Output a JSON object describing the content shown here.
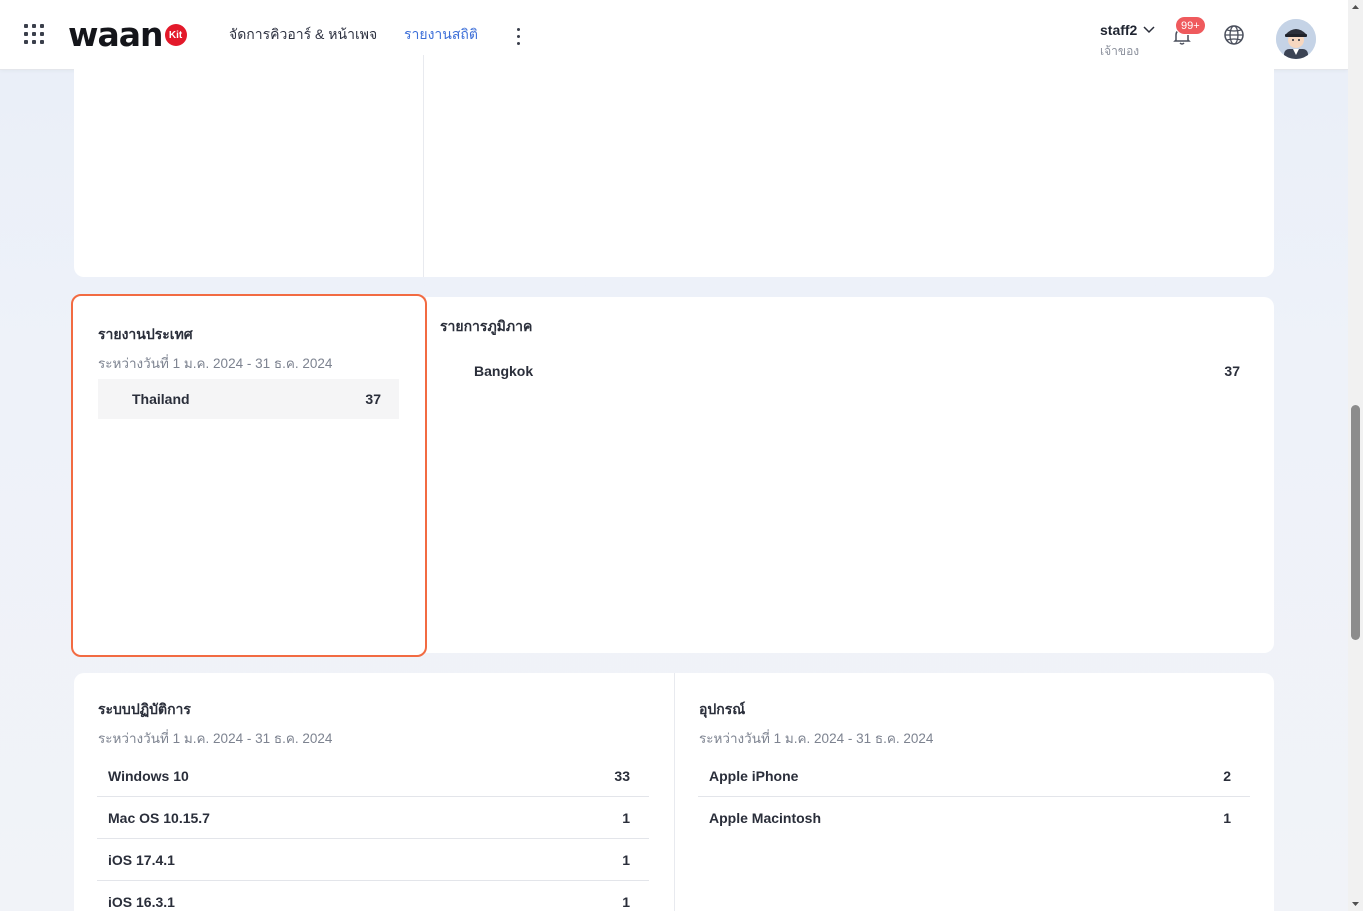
{
  "header": {
    "logo_text": "waan",
    "logo_badge": "Kit",
    "nav": {
      "queue_label": "จัดการคิวอาร์ & หน้าเพจ",
      "report_label": "รายงานสถิติ"
    },
    "user": {
      "name": "staff2",
      "role": "เจ้าของ"
    },
    "notifications_badge": "99+",
    "icons": [
      "apps-grid-icon",
      "more-vertical-icon",
      "chevron-down-icon",
      "bell-icon",
      "globe-icon"
    ]
  },
  "country_report": {
    "title": "รายงานประเทศ",
    "subtitle": "ระหว่างวันที่ 1 ม.ค. 2024 - 31 ธ.ค. 2024",
    "rows": [
      {
        "label": "Thailand",
        "value": "37"
      }
    ]
  },
  "region_report": {
    "title": "รายการภูมิภาค",
    "rows": [
      {
        "label": "Bangkok",
        "value": "37"
      }
    ]
  },
  "os_report": {
    "title": "ระบบปฏิบัติการ",
    "subtitle": "ระหว่างวันที่ 1 ม.ค. 2024 - 31 ธ.ค. 2024",
    "rows": [
      {
        "label": "Windows 10",
        "value": "33"
      },
      {
        "label": "Mac OS 10.15.7",
        "value": "1"
      },
      {
        "label": "iOS 17.4.1",
        "value": "1"
      },
      {
        "label": "iOS 16.3.1",
        "value": "1"
      }
    ]
  },
  "device_report": {
    "title": "อุปกรณ์",
    "subtitle": "ระหว่างวันที่ 1 ม.ค. 2024 - 31 ธ.ค. 2024",
    "rows": [
      {
        "label": "Apple iPhone",
        "value": "2"
      },
      {
        "label": "Apple Macintosh",
        "value": "1"
      }
    ]
  },
  "colors": {
    "accent": "#3d6fd8",
    "highlight_border": "#f26b42",
    "badge": "#ef5a5d",
    "logo_badge": "#e3192a"
  }
}
